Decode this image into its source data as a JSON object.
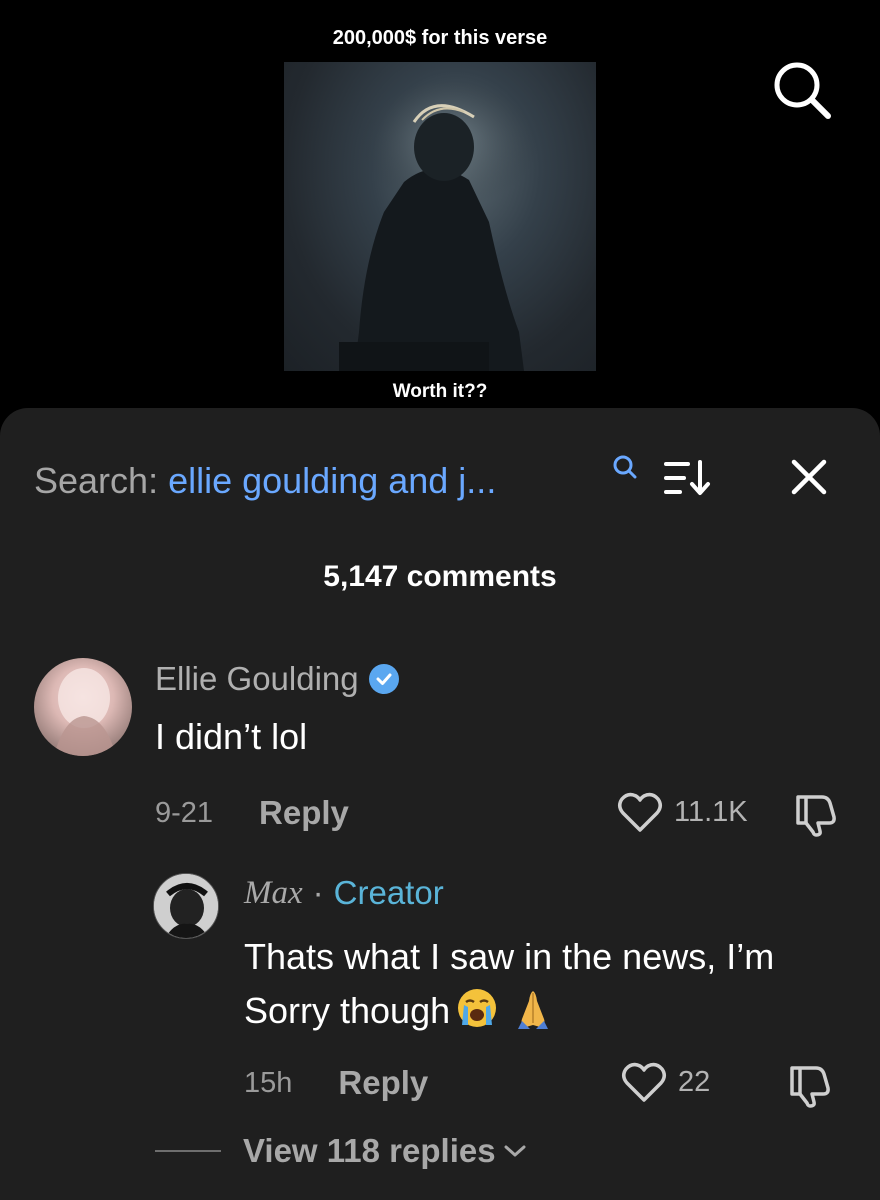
{
  "video": {
    "caption_top": "200,000$ for this verse",
    "caption_bottom": "Worth it??"
  },
  "search": {
    "prefix": "Search: ",
    "query": "ellie goulding and j..."
  },
  "comments_count": "5,147 comments",
  "comments": [
    {
      "author": "Ellie Goulding",
      "verified": true,
      "text": "I didn’t lol",
      "date": "9-21",
      "reply_label": "Reply",
      "likes": "11.1K"
    },
    {
      "author": "Max",
      "separator": "·",
      "badge": "Creator",
      "text": "Thats what I saw in the news, I’m Sorry though",
      "date": "15h",
      "reply_label": "Reply",
      "likes": "22"
    }
  ],
  "view_replies": "View 118 replies",
  "colors": {
    "sheet_bg": "#1f1f1f",
    "query_blue": "#6aa8ff",
    "creator_blue": "#5ab4d8",
    "verified_blue": "#5aa7f0"
  }
}
